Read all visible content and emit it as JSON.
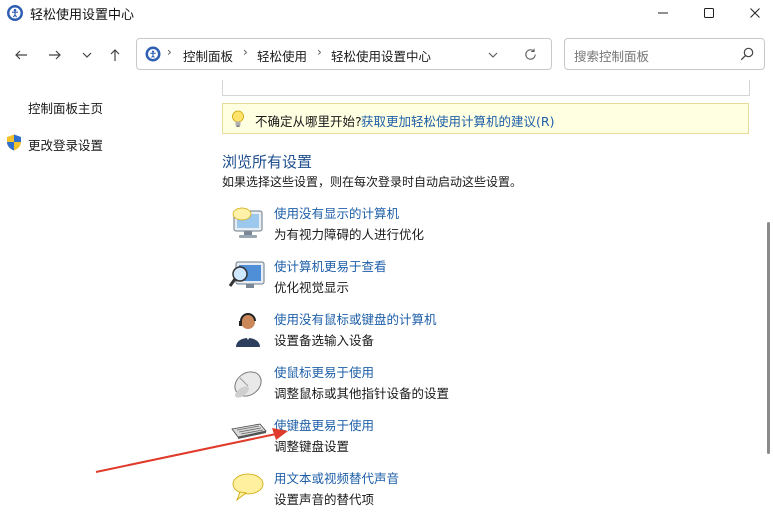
{
  "window": {
    "title": "轻松使用设置中心",
    "controls": {
      "minimize": "minimize-icon",
      "maximize": "maximize-icon",
      "close": "close-icon"
    }
  },
  "address": {
    "breadcrumbs": [
      "控制面板",
      "轻松使用",
      "轻松使用设置中心"
    ]
  },
  "search": {
    "placeholder": "搜索控制面板"
  },
  "sidebar": {
    "home": "控制面板主页",
    "login": "更改登录设置"
  },
  "tip": {
    "label": "不确定从哪里开始?",
    "link": "获取更加轻松使用计算机的建议(R)"
  },
  "section": {
    "title": "浏览所有设置",
    "subtitle": "如果选择这些设置，则在每次登录时自动启动这些设置。",
    "items": [
      {
        "link": "使用没有显示的计算机",
        "desc": "为有视力障碍的人进行优化",
        "icon": "monitor-speech-icon"
      },
      {
        "link": "使计算机更易于查看",
        "desc": "优化视觉显示",
        "icon": "magnifier-monitor-icon"
      },
      {
        "link": "使用没有鼠标或键盘的计算机",
        "desc": "设置备选输入设备",
        "icon": "user-headset-icon"
      },
      {
        "link": "使鼠标更易于使用",
        "desc": "调整鼠标或其他指针设备的设置",
        "icon": "mouse-icon"
      },
      {
        "link": "使键盘更易于使用",
        "desc": "调整键盘设置",
        "icon": "keyboard-icon"
      },
      {
        "link": "用文本或视频替代声音",
        "desc": "设置声音的替代项",
        "icon": "speech-bubble-icon"
      }
    ]
  },
  "colors": {
    "link": "#1e5fa8",
    "heading": "#1e4e8c",
    "tip_bg": "#ffffe1",
    "annotation_arrow": "#e03a2a"
  }
}
